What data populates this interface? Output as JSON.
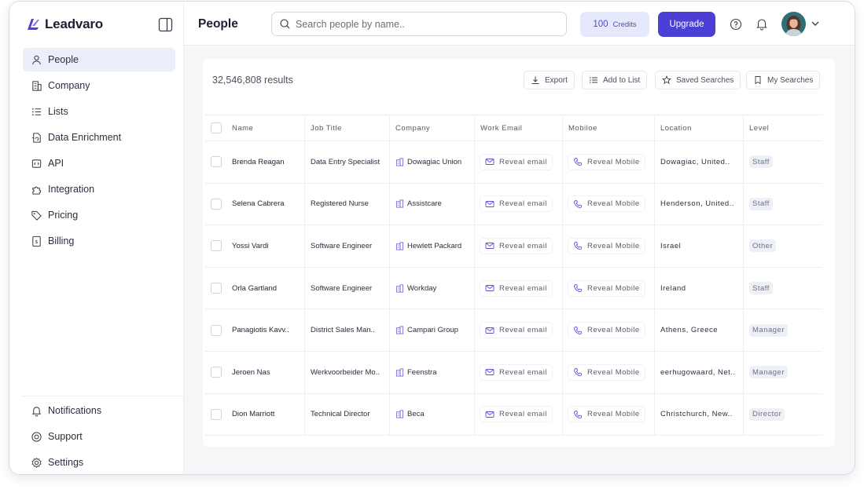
{
  "brand": {
    "name": "Leadvaro",
    "accent": "#4b3fd4"
  },
  "sidebar": {
    "items": [
      {
        "label": "People",
        "icon": "user-icon",
        "active": true
      },
      {
        "label": "Company",
        "icon": "building-icon"
      },
      {
        "label": "Lists",
        "icon": "list-icon"
      },
      {
        "label": "Data Enrichment",
        "icon": "file-sync-icon"
      },
      {
        "label": "API",
        "icon": "code-file-icon"
      },
      {
        "label": "Integration",
        "icon": "puzzle-icon"
      },
      {
        "label": "Pricing",
        "icon": "tag-icon"
      },
      {
        "label": "Billing",
        "icon": "invoice-icon"
      }
    ],
    "bottom": [
      {
        "label": "Notifications",
        "icon": "bell-icon"
      },
      {
        "label": "Support",
        "icon": "lifebuoy-icon"
      },
      {
        "label": "Settings",
        "icon": "gear-icon"
      }
    ]
  },
  "header": {
    "title": "People",
    "search_placeholder": "Search people by name..",
    "credits_value": "100",
    "credits_label": "Credits",
    "upgrade_label": "Upgrade"
  },
  "results": {
    "count_text": "32,546,808 results",
    "actions": {
      "export": "Export",
      "add_to_list": "Add to List",
      "saved_searches": "Saved Searches",
      "my_searches": "My Searches"
    }
  },
  "table": {
    "columns": [
      "Name",
      "Job Title",
      "Company",
      "Work Email",
      "Mobiloe",
      "Location",
      "Level"
    ],
    "reveal_email": "Reveal email",
    "reveal_mobile": "Reveal Mobile",
    "rows": [
      {
        "name": "Brenda Reagan",
        "title": "Data Entry Specialist",
        "company": "Dowagiac Union",
        "location": "Dowagiac, United..",
        "level": "Staff"
      },
      {
        "name": "Selena Cabrera",
        "title": "Registered Nurse",
        "company": "Assistcare",
        "location": "Henderson, United..",
        "level": "Staff"
      },
      {
        "name": "Yossi Vardi",
        "title": "Software Engineer",
        "company": "Hewlett Packard",
        "location": "Israel",
        "level": "Other"
      },
      {
        "name": "Orla Gartland",
        "title": "Software Engineer",
        "company": "Workday",
        "location": "Ireland",
        "level": "Staff"
      },
      {
        "name": "Panagiotis Kavv..",
        "title": "District Sales Man..",
        "company": "Campari Group",
        "location": "Athens, Greece",
        "level": "Manager"
      },
      {
        "name": "Jeroen Nas",
        "title": "Werkvoorbeider Mo..",
        "company": "Feenstra",
        "location": "eerhugowaard, Net..",
        "level": "Manager"
      },
      {
        "name": "Dion Marriott",
        "title": "Technical Director",
        "company": "Beca",
        "location": "Christchurch, New..",
        "level": "Director"
      }
    ]
  }
}
